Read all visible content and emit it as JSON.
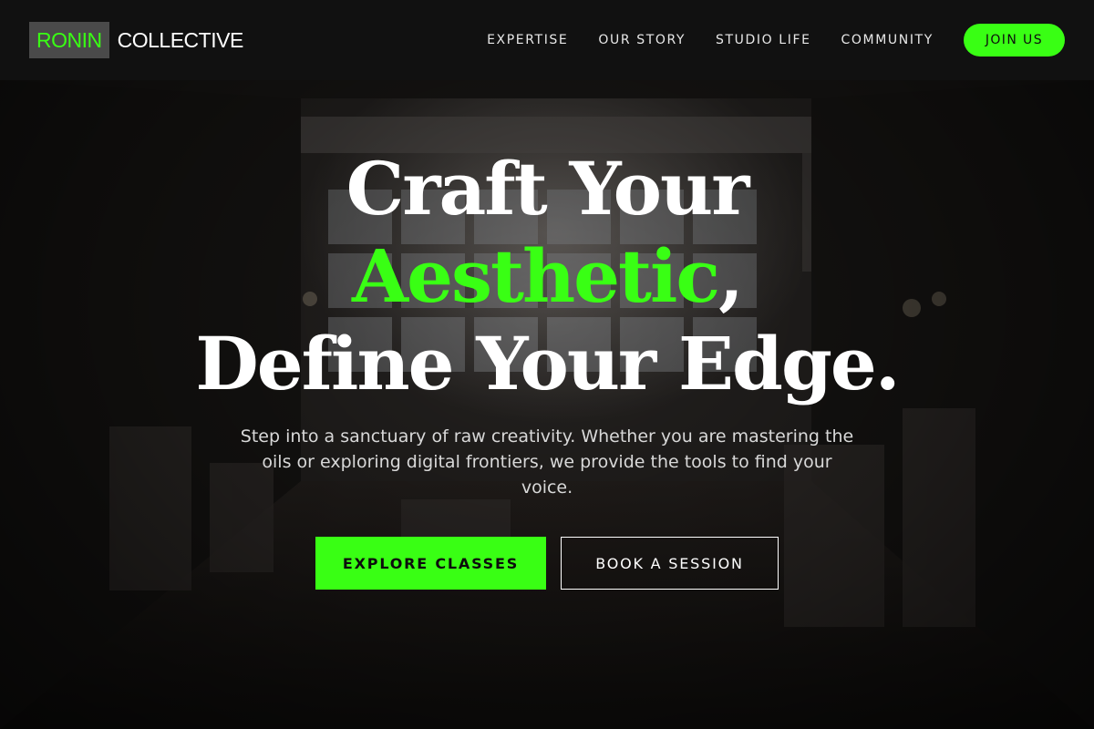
{
  "header": {
    "logo_highlight": "RONIN",
    "logo_rest": "COLLECTIVE",
    "nav": [
      "EXPERTISE",
      "OUR STORY",
      "STUDIO LIFE",
      "COMMUNITY"
    ],
    "join_label": "JOIN US"
  },
  "hero": {
    "line1": "Craft Your",
    "line2_accent": "Aesthetic",
    "line2_punct": ",",
    "line3": "Define Your Edge.",
    "subtext": "Step into a sanctuary of raw creativity. Whether you are mastering the oils or exploring digital frontiers, we provide the tools to find your voice.",
    "primary_cta": "EXPLORE CLASSES",
    "secondary_cta": "BOOK A SESSION"
  },
  "colors": {
    "accent": "#39ff14",
    "background": "#0d0d0d",
    "logo_box": "#4a4a4a"
  }
}
